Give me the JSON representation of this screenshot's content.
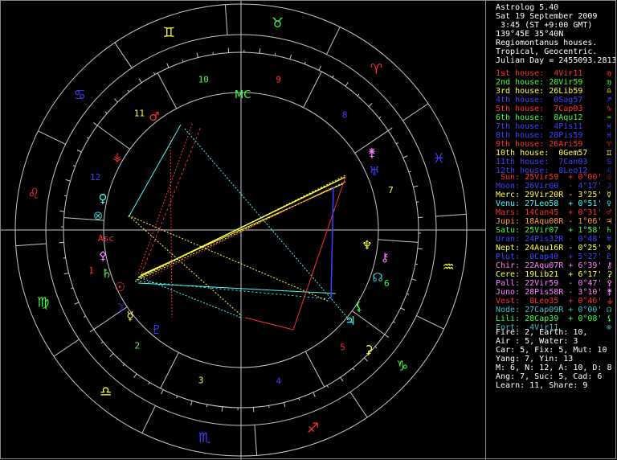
{
  "header": {
    "lines": [
      "Astrolog 5.40",
      "Sat 19 September 2009",
      " 3:45 (ST +9:00 GMT)",
      "139°45E 35°40N",
      "Regiomontanus houses.",
      "Tropical, Geocentric.",
      "Julian Day = 2455093.2813"
    ]
  },
  "houses": [
    {
      "text": "1st house:  4Vir11",
      "color": "#ff3030",
      "glyph": "♍"
    },
    {
      "text": "2nd house: 28Vir59",
      "color": "#40ff40",
      "glyph": "♍"
    },
    {
      "text": "3rd house: 26Lib59",
      "color": "#ffff40",
      "glyph": "♎"
    },
    {
      "text": "4th house:  0Sag57",
      "color": "#4040ff",
      "glyph": "♐"
    },
    {
      "text": "5th house:  7Cap03",
      "color": "#ff3030",
      "glyph": "♑"
    },
    {
      "text": "6th house:  8Aqu12",
      "color": "#40ff40",
      "glyph": "♒"
    },
    {
      "text": "7th house:  4Pis11",
      "color": "#4040ff",
      "glyph": "♓"
    },
    {
      "text": "8th house: 28Pis59",
      "color": "#4040ff",
      "glyph": "♓"
    },
    {
      "text": "9th house: 26Ari59",
      "color": "#ff3030",
      "glyph": "♈"
    },
    {
      "text": "10th house:  0Gem57",
      "color": "#ffff40",
      "glyph": "♊"
    },
    {
      "text": "11th house:  7Can03",
      "color": "#4040ff",
      "glyph": "♋"
    },
    {
      "text": "12th house:  8Leo12",
      "color": "#4040ff",
      "glyph": "♌"
    }
  ],
  "planets": [
    {
      "text": " Sun: 25Vir59  + 0°00'",
      "color": "#ff3030",
      "glyph": "☉"
    },
    {
      "text": "Moon: 26Vir00  - 4°17'",
      "color": "#4040ff",
      "glyph": "☽"
    },
    {
      "text": "Merc: 29Vir20R - 3°25'",
      "color": "#ffff40",
      "glyph": "☿"
    },
    {
      "text": "Venu: 27Leo58  + 0°51'",
      "color": "#40ffff",
      "glyph": "♀"
    },
    {
      "text": "Mars: 14Can45  + 0°31'",
      "color": "#ff3030",
      "glyph": "♂"
    },
    {
      "text": "Jupi: 18Aqu08R - 1°06'",
      "color": "#ffa030",
      "glyph": "♃"
    },
    {
      "text": "Satu: 25Vir07  + 1°58'",
      "color": "#40ff40",
      "glyph": "♄"
    },
    {
      "text": "Uran: 24Pis32R - 0°48'",
      "color": "#4040ff",
      "glyph": "♅"
    },
    {
      "text": "Nept: 24Aqu16R - 0°25'",
      "color": "#ffff40",
      "glyph": "♆"
    },
    {
      "text": "Plut:  0Cap40  + 5°27'",
      "color": "#4040ff",
      "glyph": "♇"
    },
    {
      "text": "Chir: 22Aqu07R + 6°39'",
      "color": "#ff80ff",
      "glyph": "⚷"
    },
    {
      "text": "Cere: 19Lib21  + 6°17'",
      "color": "#ffff40",
      "glyph": "⚳"
    },
    {
      "text": "Pall: 22Vir59  - 0°47'",
      "color": "#ff80ff",
      "glyph": "⚴"
    },
    {
      "text": "Juno: 28Pis58R - 3°10'",
      "color": "#ff80ff",
      "glyph": "⚵"
    },
    {
      "text": "Vest:  8Leo35  + 0°46'",
      "color": "#ff3030",
      "glyph": "⚶"
    },
    {
      "text": "Node: 27Cap09R + 0°00'",
      "color": "#40c0c0",
      "glyph": "☊"
    },
    {
      "text": "Lili: 28Cap39  + 0°08'",
      "color": "#40ff40",
      "glyph": "⚸"
    },
    {
      "text": "Fort:  4Vir11",
      "color": "#40c0c0",
      "glyph": "⊗"
    }
  ],
  "summary": [
    "Fire: 2, Earth: 10,",
    "Air : 5, Water: 3",
    "Car: 5, Fix: 5, Mut: 10",
    "Yang: 7, Yin: 13",
    "M: 6, N: 12, A: 10, D: 8",
    "Ang: 7, Suc: 5, Cad: 6",
    "Learn: 11, Share: 9"
  ],
  "chart": {
    "asc_label": "Asc",
    "mc_label": "MC",
    "house_numbers": [
      "1",
      "2",
      "3",
      "4",
      "5",
      "6",
      "7",
      "8",
      "9",
      "10",
      "11",
      "12"
    ],
    "signs": [
      {
        "glyph": "♊",
        "color": "#ffff40"
      },
      {
        "glyph": "♉",
        "color": "#40ff40"
      },
      {
        "glyph": "♈",
        "color": "#ff3030"
      },
      {
        "glyph": "♓",
        "color": "#4040ff"
      },
      {
        "glyph": "♒",
        "color": "#ffff40"
      },
      {
        "glyph": "♑",
        "color": "#40ff40"
      },
      {
        "glyph": "♐",
        "color": "#ff3030"
      },
      {
        "glyph": "♏",
        "color": "#4040ff"
      },
      {
        "glyph": "♎",
        "color": "#ffff40"
      },
      {
        "glyph": "♍",
        "color": "#40ff40"
      },
      {
        "glyph": "♌",
        "color": "#ff3030"
      },
      {
        "glyph": "♋",
        "color": "#4040ff"
      }
    ]
  }
}
